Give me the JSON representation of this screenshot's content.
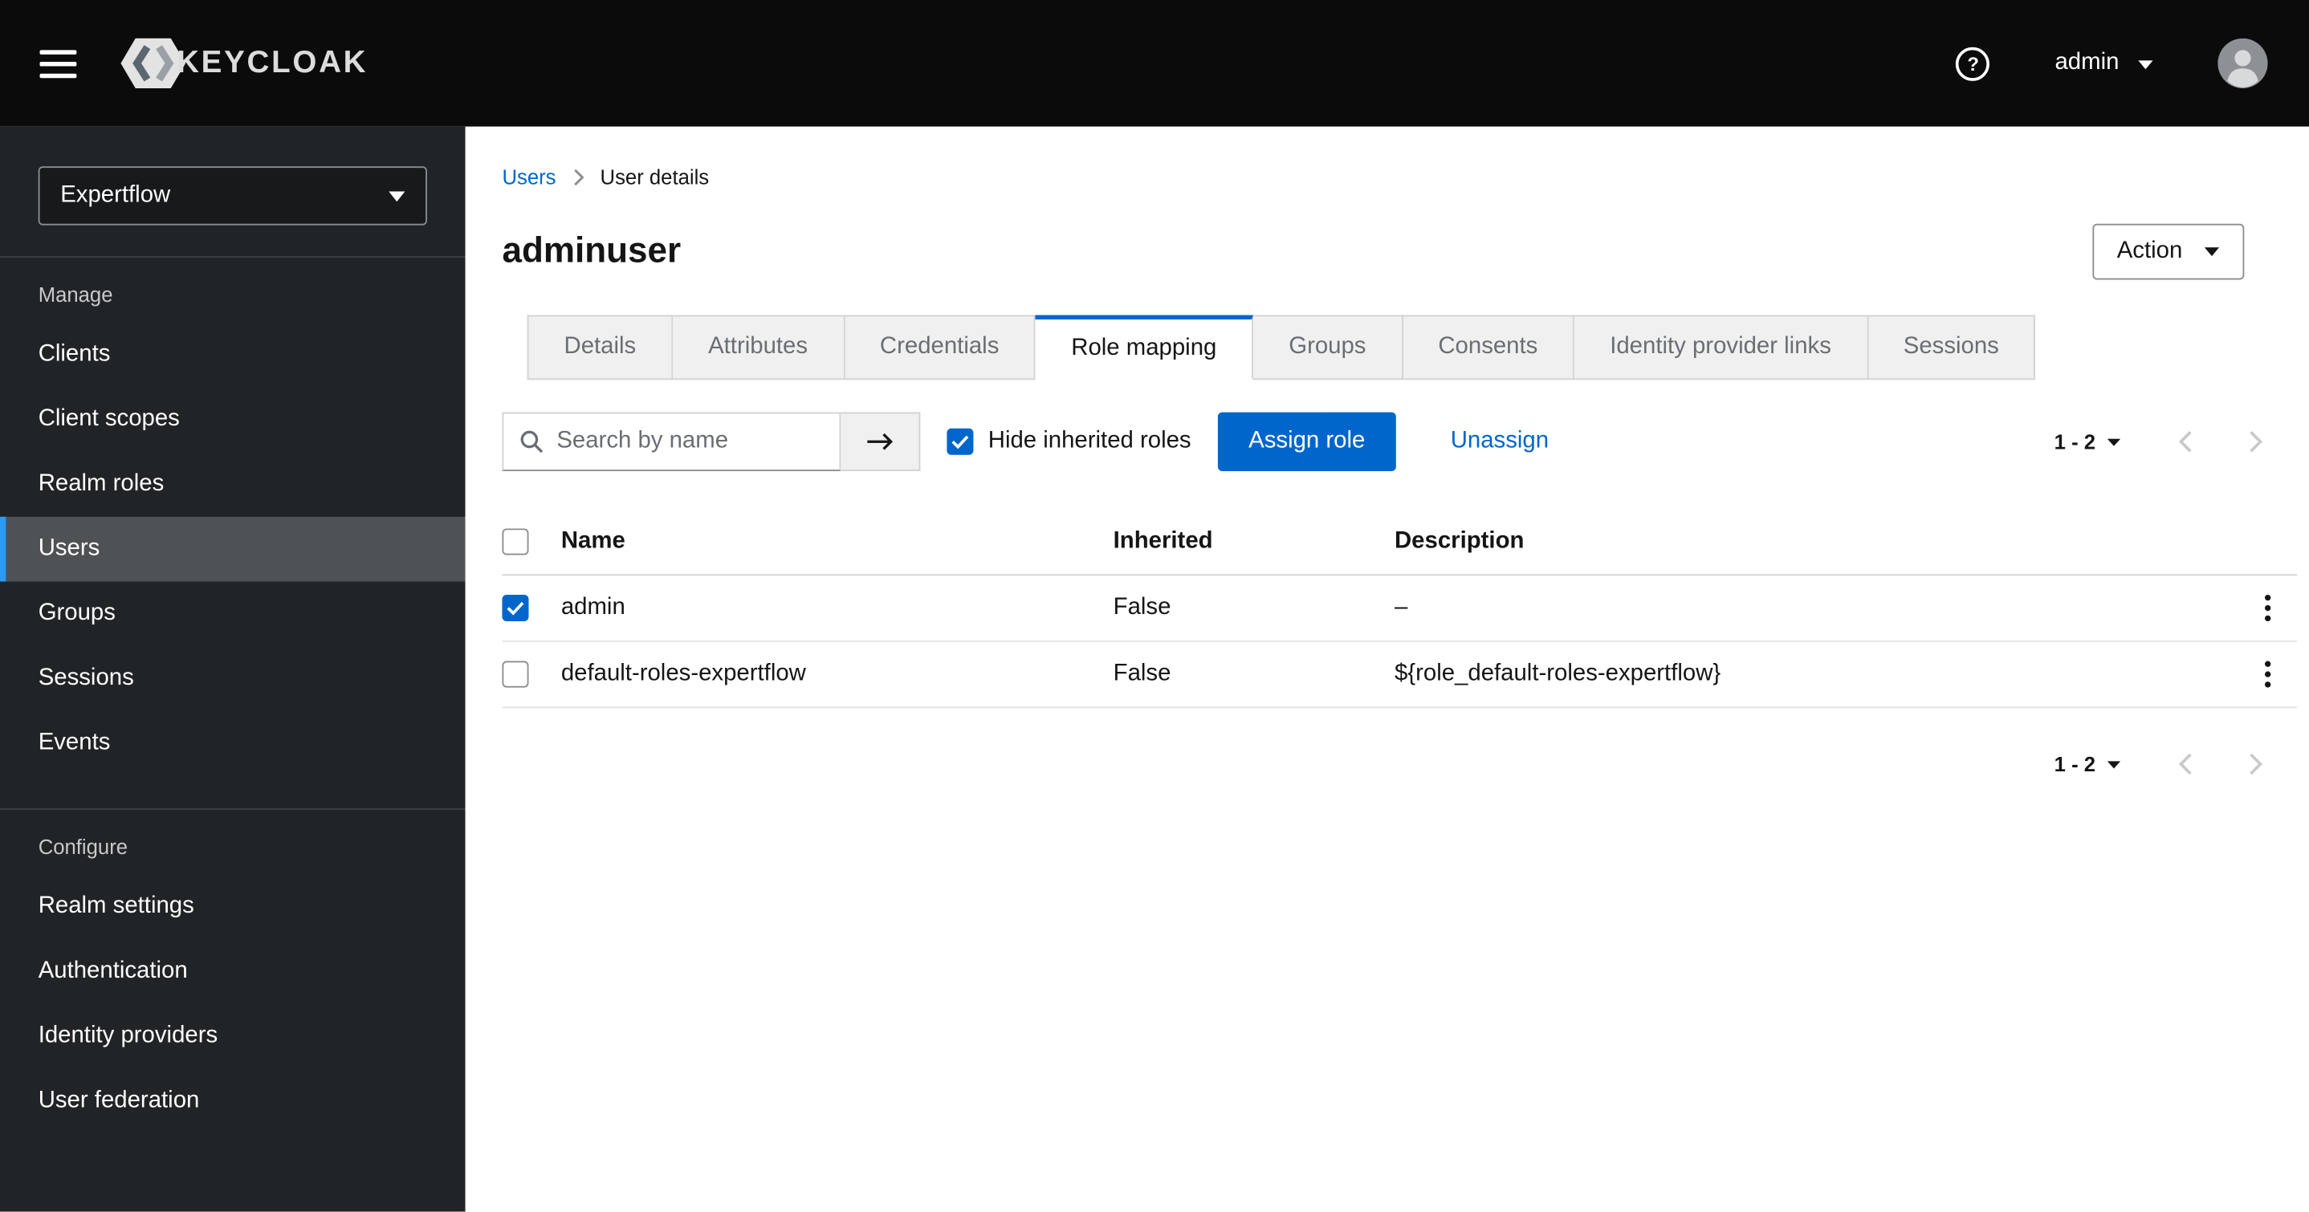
{
  "colors": {
    "primary": "#0066cc",
    "link": "#0066cc",
    "nav_current_accent": "#2b9af3",
    "header_bg": "#0b0b0c",
    "sidebar_bg": "#212427"
  },
  "header": {
    "brand": "KEYCLOAK",
    "help_icon_glyph": "?",
    "username": "admin"
  },
  "sidebar": {
    "realm_selector": {
      "value": "Expertflow"
    },
    "sections": [
      {
        "label": "Manage",
        "items": [
          {
            "label": "Clients",
            "current": false
          },
          {
            "label": "Client scopes",
            "current": false
          },
          {
            "label": "Realm roles",
            "current": false
          },
          {
            "label": "Users",
            "current": true
          },
          {
            "label": "Groups",
            "current": false
          },
          {
            "label": "Sessions",
            "current": false
          },
          {
            "label": "Events",
            "current": false
          }
        ]
      },
      {
        "label": "Configure",
        "items": [
          {
            "label": "Realm settings",
            "current": false
          },
          {
            "label": "Authentication",
            "current": false
          },
          {
            "label": "Identity providers",
            "current": false
          },
          {
            "label": "User federation",
            "current": false
          }
        ]
      }
    ]
  },
  "breadcrumb": {
    "parent": "Users",
    "current": "User details"
  },
  "page": {
    "title": "adminuser",
    "action_button": "Action"
  },
  "tabs": [
    {
      "label": "Details",
      "active": false
    },
    {
      "label": "Attributes",
      "active": false
    },
    {
      "label": "Credentials",
      "active": false
    },
    {
      "label": "Role mapping",
      "active": true
    },
    {
      "label": "Groups",
      "active": false
    },
    {
      "label": "Consents",
      "active": false
    },
    {
      "label": "Identity provider links",
      "active": false
    },
    {
      "label": "Sessions",
      "active": false
    }
  ],
  "toolbar": {
    "search_placeholder": "Search by name",
    "hide_inherited_label": "Hide inherited roles",
    "hide_inherited_checked": true,
    "assign_button": "Assign role",
    "unassign_link": "Unassign"
  },
  "pagination": {
    "range": "1 - 2"
  },
  "table": {
    "columns": {
      "name": "Name",
      "inherited": "Inherited",
      "description": "Description"
    },
    "select_all_checked": false,
    "rows": [
      {
        "selected": true,
        "name": "admin",
        "inherited": "False",
        "description": "–"
      },
      {
        "selected": false,
        "name": "default-roles-expertflow",
        "inherited": "False",
        "description": "${role_default-roles-expertflow}"
      }
    ]
  }
}
